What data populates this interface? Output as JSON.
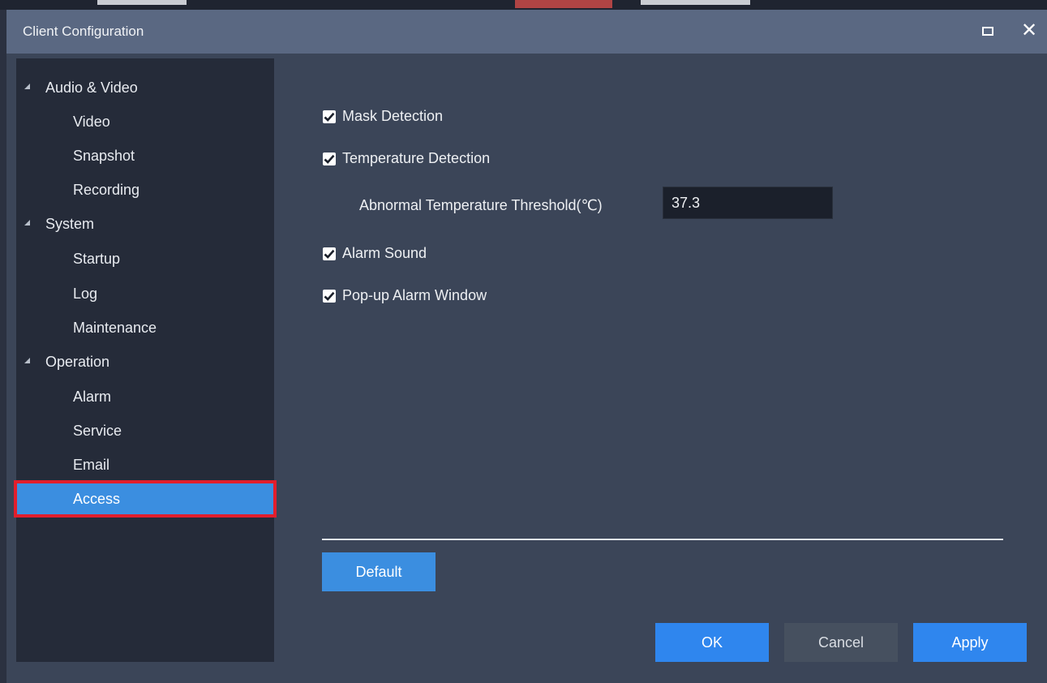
{
  "window": {
    "title": "Client Configuration"
  },
  "sidebar": {
    "items": [
      {
        "label": "Audio & Video",
        "type": "group"
      },
      {
        "label": "Video",
        "type": "sub"
      },
      {
        "label": "Snapshot",
        "type": "sub"
      },
      {
        "label": "Recording",
        "type": "sub"
      },
      {
        "label": "System",
        "type": "group"
      },
      {
        "label": "Startup",
        "type": "sub"
      },
      {
        "label": "Log",
        "type": "sub"
      },
      {
        "label": "Maintenance",
        "type": "sub"
      },
      {
        "label": "Operation",
        "type": "group"
      },
      {
        "label": "Alarm",
        "type": "sub"
      },
      {
        "label": "Service",
        "type": "sub"
      },
      {
        "label": "Email",
        "type": "sub"
      },
      {
        "label": "Access",
        "type": "sub",
        "selected": true
      }
    ]
  },
  "settings": {
    "mask_detection": {
      "label": "Mask Detection",
      "checked": true
    },
    "temperature_detection": {
      "label": "Temperature Detection",
      "checked": true
    },
    "threshold": {
      "label": "Abnormal Temperature Threshold(℃)",
      "value": "37.3"
    },
    "alarm_sound": {
      "label": "Alarm Sound",
      "checked": true
    },
    "popup_alarm": {
      "label": "Pop-up Alarm Window",
      "checked": true
    }
  },
  "buttons": {
    "default": "Default",
    "ok": "OK",
    "cancel": "Cancel",
    "apply": "Apply"
  },
  "colors": {
    "accent": "#3b8ee0",
    "highlight_frame": "#e21e2c",
    "titlebar": "#5a6882",
    "panel": "#3b4558",
    "sidebar": "#252b39"
  }
}
